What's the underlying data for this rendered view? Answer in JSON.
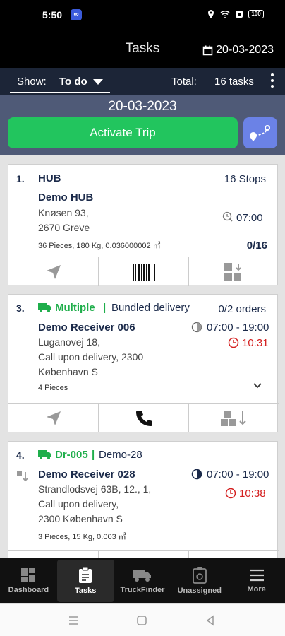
{
  "status_bar": {
    "time": "5:50",
    "battery": "100"
  },
  "header": {
    "title": "Tasks",
    "date": "20-03-2023"
  },
  "filter": {
    "show_label": "Show:",
    "show_value": "To do",
    "total_label": "Total:",
    "total_value": "16 tasks"
  },
  "date_bar": {
    "date": "20-03-2023",
    "activate_label": "Activate Trip"
  },
  "cards": [
    {
      "number": "1.",
      "name": "HUB",
      "stops": "16 Stops",
      "company": "Demo HUB",
      "address1": "Knøsen 93,",
      "address2": "2670 Greve",
      "time": "07:00",
      "details": "36 Pieces, 180 Kg, 0.036000002 ㎥",
      "progress": "0/16"
    },
    {
      "number": "3.",
      "route": "Multiple",
      "separator": "|",
      "type": "Bundled delivery",
      "orders": "0/2 orders",
      "company": "Demo Receiver 006",
      "address1": "Luganovej 18,",
      "address2": "Call upon delivery, 2300",
      "address3": "København S",
      "window": "07:00 - 19:00",
      "eta": "10:31",
      "details": "4 Pieces"
    },
    {
      "number": "4.",
      "route": "Dr-005",
      "separator": "|",
      "type": "Demo-28",
      "company": "Demo Receiver 028",
      "address1": "Strandlodsvej 63B, 12., 1,",
      "address2": "Call upon delivery,",
      "address3": "2300 København S",
      "window": "07:00 - 19:00",
      "eta": "10:38",
      "details": "3 Pieces, 15 Kg, 0.003 ㎥"
    }
  ],
  "bottom_nav": [
    {
      "label": "Dashboard"
    },
    {
      "label": "Tasks"
    },
    {
      "label": "TruckFinder"
    },
    {
      "label": "Unassigned"
    },
    {
      "label": "More"
    }
  ],
  "colors": {
    "accent_green": "#22c55e",
    "route_blue": "#6b82e6",
    "eta_red": "#d42020",
    "header_black": "#000000",
    "filter_navy": "#1c2537"
  }
}
